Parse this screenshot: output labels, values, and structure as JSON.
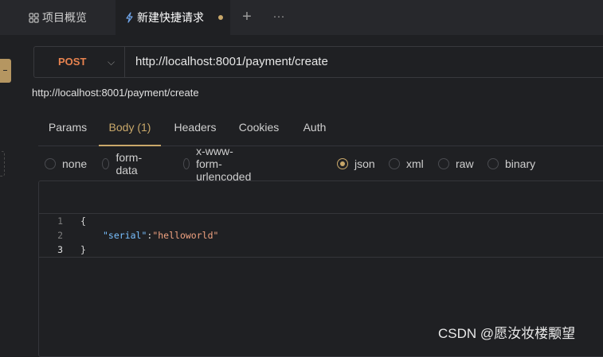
{
  "tabs": {
    "overview_icon": "grid-icon",
    "overview_label": "项目概览",
    "active_icon": "lightning-icon",
    "active_label": "新建快捷请求",
    "add_label": "+",
    "more_label": "···"
  },
  "request": {
    "method": "POST",
    "url": "http://localhost:8001/payment/create",
    "url_echo": "http://localhost:8001/payment/create"
  },
  "subtabs": [
    "Params",
    "Body (1)",
    "Headers",
    "Cookies",
    "Auth"
  ],
  "body_types": [
    {
      "label": "none",
      "selected": false
    },
    {
      "label": "form-data",
      "selected": false
    },
    {
      "label": "x-www-form-urlencoded",
      "selected": false
    },
    {
      "label": "json",
      "selected": true
    },
    {
      "label": "xml",
      "selected": false
    },
    {
      "label": "raw",
      "selected": false
    },
    {
      "label": "binary",
      "selected": false
    }
  ],
  "editor": {
    "line_numbers": [
      "1",
      "2",
      "3"
    ],
    "line1": "{",
    "line2_key": "\"serial\"",
    "line2_colon": ":",
    "line2_value": "\"helloworld\"",
    "line3": "}"
  },
  "watermark": "CSDN @愿汝妆楼颙望",
  "colors": {
    "accent": "#c9a86a",
    "method": "#e8834f",
    "json_key": "#79c0ff",
    "json_string": "#f0a280",
    "background": "#1f2023"
  }
}
